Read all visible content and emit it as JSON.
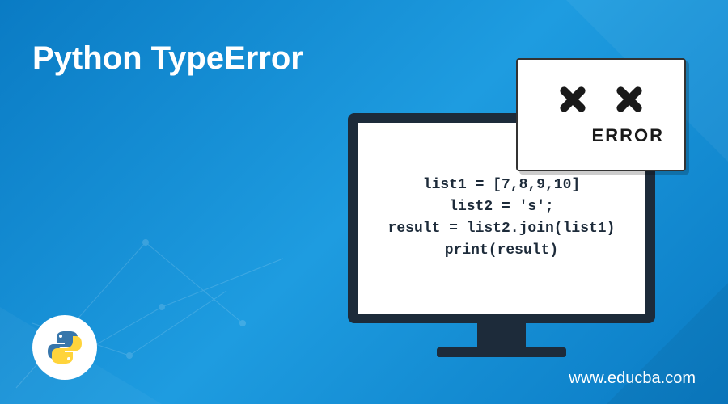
{
  "title": "Python TypeError",
  "code": {
    "line1": "list1 = [7,8,9,10]",
    "line2": "list2 = 's';",
    "line3": "result = list2.join(list1)",
    "line4": "print(result)"
  },
  "error": {
    "label": "ERROR"
  },
  "website": "www.educba.com",
  "icons": {
    "x": "x-icon",
    "python": "python-logo"
  }
}
